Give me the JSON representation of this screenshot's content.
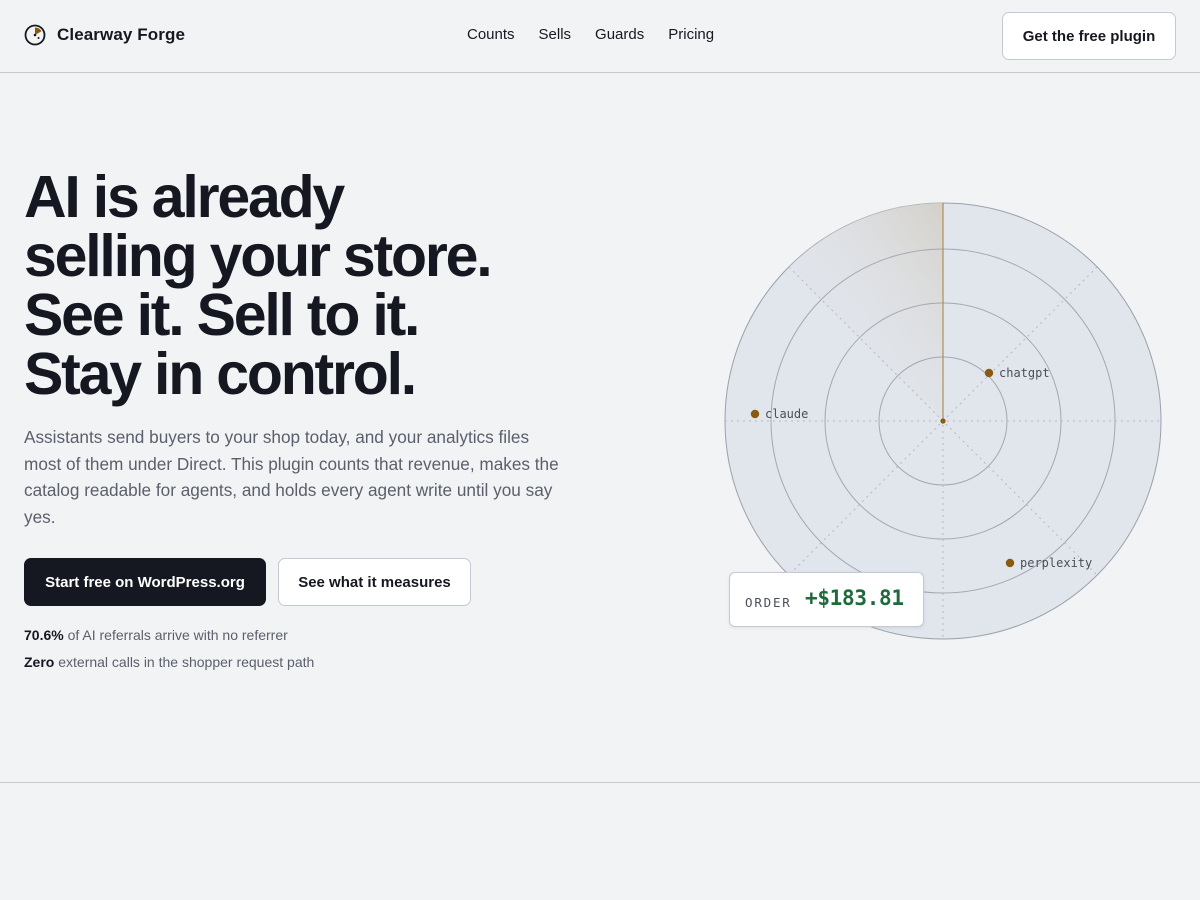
{
  "brand": {
    "name": "Clearway Forge",
    "logo_icon": "radar-sweep-icon",
    "accent_color": "#8a5a12"
  },
  "nav": {
    "items": [
      "Counts",
      "Sells",
      "Guards",
      "Pricing"
    ]
  },
  "header": {
    "cta_label": "Get the free plugin"
  },
  "hero": {
    "title_lines": [
      "AI is already",
      "selling your store.",
      "See it. Sell to it.",
      "Stay in control."
    ],
    "lede": "Assistants send buyers to your shop today, and your analytics files most of them under Direct. This plugin counts that revenue, makes the catalog readable for agents, and holds every agent write until you say yes.",
    "primary_cta": "Start free on WordPress.org",
    "secondary_cta": "See what it measures",
    "stats": [
      {
        "strong": "70.6%",
        "text": " of AI referrals arrive with no referrer"
      },
      {
        "strong": "Zero",
        "text": " external calls in the shopper request path"
      }
    ]
  },
  "radar": {
    "blips": [
      {
        "label": "chatgpt"
      },
      {
        "label": "claude"
      },
      {
        "label": "perplexity"
      }
    ],
    "blip_color": "#8a5a12",
    "order": {
      "label": "ORDER",
      "value": "+$183.81",
      "value_color": "#1f6a3c"
    }
  }
}
